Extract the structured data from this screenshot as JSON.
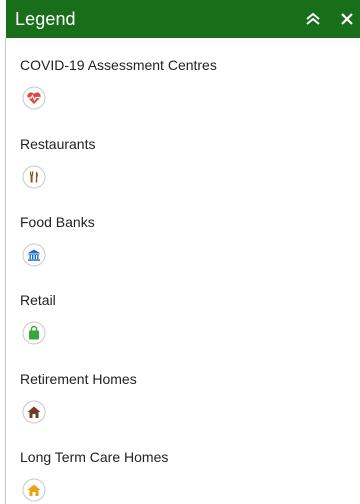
{
  "header": {
    "title": "Legend",
    "background_color": "#196e19",
    "collapse_icon": "double-chevron-up-icon",
    "close_icon": "close-icon"
  },
  "legend": {
    "items": [
      {
        "label": "COVID-19 Assessment Centres",
        "icon": "heart-pulse-icon",
        "color": "#d94a4a"
      },
      {
        "label": "Restaurants",
        "icon": "fork-knife-icon",
        "color": "#7a5a2a"
      },
      {
        "label": "Food Banks",
        "icon": "bank-icon",
        "color": "#1e6fc2"
      },
      {
        "label": "Retail",
        "icon": "shopping-bag-icon",
        "color": "#3aa63a"
      },
      {
        "label": "Retirement Homes",
        "icon": "house-icon",
        "color": "#6b3f1f"
      },
      {
        "label": "Long Term Care Homes",
        "icon": "house-icon",
        "color": "#e8a317"
      }
    ]
  }
}
